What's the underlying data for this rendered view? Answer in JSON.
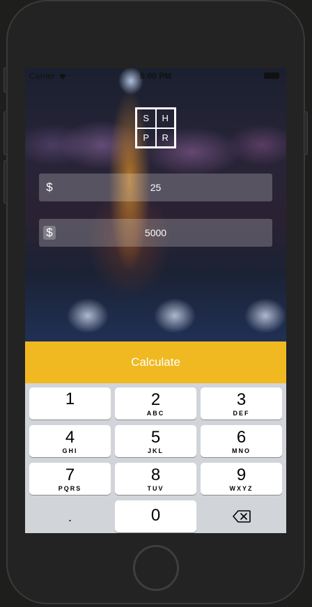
{
  "status_bar": {
    "carrier": "Carrier",
    "time": "5:00 PM"
  },
  "logo": {
    "letters": [
      "S",
      "H",
      "P",
      "R"
    ]
  },
  "fields": [
    {
      "currency": "$",
      "value": "25"
    },
    {
      "currency": "$",
      "value": "5000"
    }
  ],
  "calculate_label": "Calculate",
  "keypad": [
    {
      "num": "1",
      "letters": ""
    },
    {
      "num": "2",
      "letters": "ABC"
    },
    {
      "num": "3",
      "letters": "DEF"
    },
    {
      "num": "4",
      "letters": "GHI"
    },
    {
      "num": "5",
      "letters": "JKL"
    },
    {
      "num": "6",
      "letters": "MNO"
    },
    {
      "num": "7",
      "letters": "PQRS"
    },
    {
      "num": "8",
      "letters": "TUV"
    },
    {
      "num": "9",
      "letters": "WXYZ"
    },
    {
      "num": ".",
      "letters": ""
    },
    {
      "num": "0",
      "letters": ""
    }
  ],
  "icons": {
    "delete": "backspace-icon",
    "wifi": "wifi-icon",
    "battery": "battery-icon"
  },
  "colors": {
    "accent": "#f0b921",
    "keyboard_bg": "#d1d4d9"
  }
}
